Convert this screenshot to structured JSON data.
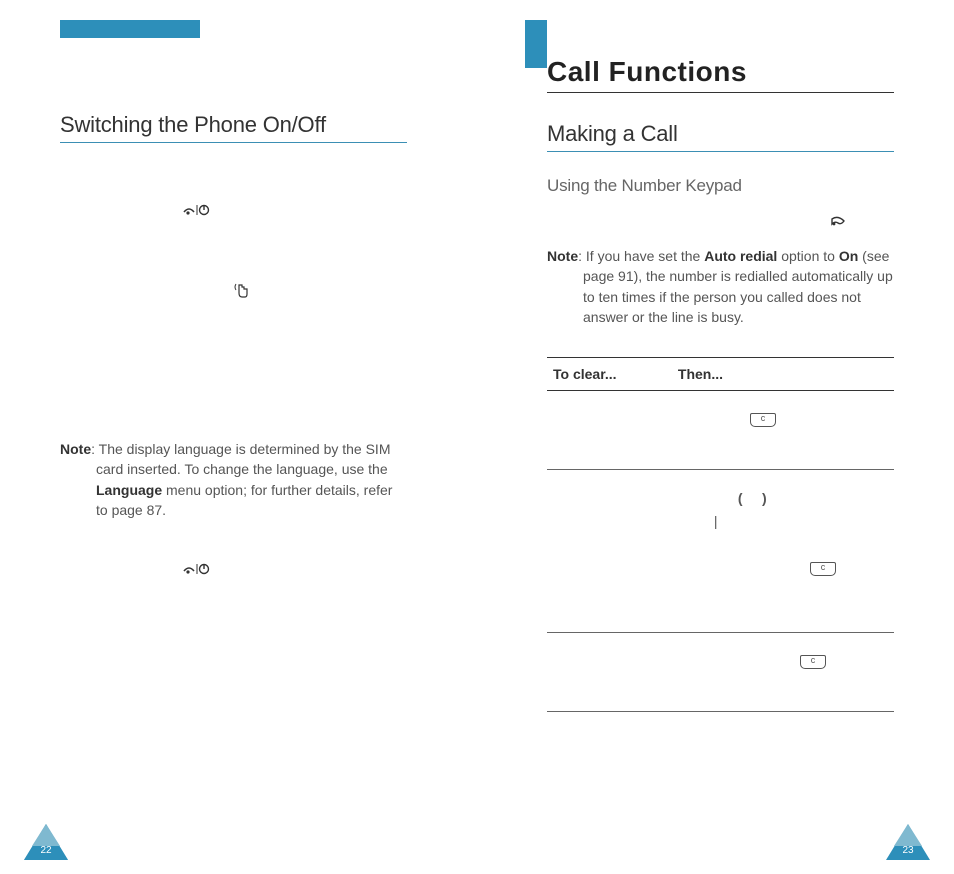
{
  "leftPage": {
    "section_title": "Switching the Phone On/Off",
    "note_label": "Note",
    "note_body": ": The display language is determined by the SIM card inserted. To change the language, use the ",
    "note_bold": "Language",
    "note_body2": " menu option; for further details, refer to page 87.",
    "page_number": "22"
  },
  "rightPage": {
    "chapter_title": "Call Functions",
    "section_title": "Making a Call",
    "subsection_title": "Using the Number Keypad",
    "note_label": "Note",
    "note_body1": ": If you have set the ",
    "note_bold1": "Auto redial",
    "note_body2": " option to ",
    "note_bold2": "On",
    "note_body3": " (see page 91), the number is redialled automatically up to ten times if the person you called does not answer or the line is busy.",
    "table": {
      "header1": "To clear...",
      "header2": "Then..."
    },
    "page_number": "23"
  },
  "icons": {
    "pwr_key": "end-power-key-icon",
    "tap": "tap-icon",
    "phone": "dial-icon",
    "c_key": "c-key-icon"
  }
}
